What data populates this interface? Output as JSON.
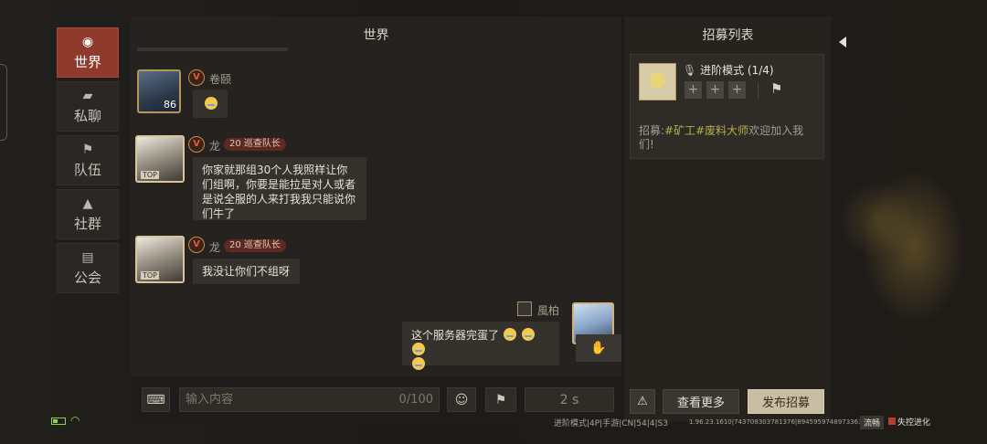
{
  "sidebar": {
    "items": [
      {
        "label": "世界",
        "icon": "globe-icon",
        "active": true
      },
      {
        "label": "私聊",
        "icon": "chat-bubble-icon",
        "active": false
      },
      {
        "label": "队伍",
        "icon": "flag-icon",
        "active": false
      },
      {
        "label": "社群",
        "icon": "campfire-icon",
        "active": false
      },
      {
        "label": "公会",
        "icon": "banner-icon",
        "active": false
      }
    ]
  },
  "chat": {
    "title": "世界",
    "messages": [
      {
        "user": "卷颐",
        "level": "86",
        "vip": "V",
        "content_type": "emoji"
      },
      {
        "user": "龙",
        "vip": "V",
        "tag": "20 巡查队长",
        "text": "你家就那组30个人我照样让你们组啊，你要是能拉是对人或者是说全服的人来打我我只能说你们牛了"
      },
      {
        "user": "龙",
        "vip": "V",
        "tag": "20 巡查队长",
        "text": "我没让你们不组呀"
      },
      {
        "user": "風柏",
        "self": true,
        "text": "这个服务器完蛋了"
      }
    ],
    "input_placeholder": "输入内容",
    "char_count": "0/100",
    "cooldown": "2 s"
  },
  "recruit": {
    "title": "招募列表",
    "card": {
      "mode": "进阶模式 (1/4)",
      "slot_symbol": "+",
      "text_prefix": "招募:",
      "text_highlight": "#矿工#废料大师",
      "text_suffix": "欢迎加入我们!"
    },
    "more_label": "查看更多",
    "publish_label": "发布招募"
  },
  "status": {
    "server_info": "进阶模式|4P|手游|CN|54|4|S3",
    "build": "1.96.23.1610|743708303781376|89459597489733634",
    "smooth": "流畅",
    "logo_text": "失控进化"
  }
}
